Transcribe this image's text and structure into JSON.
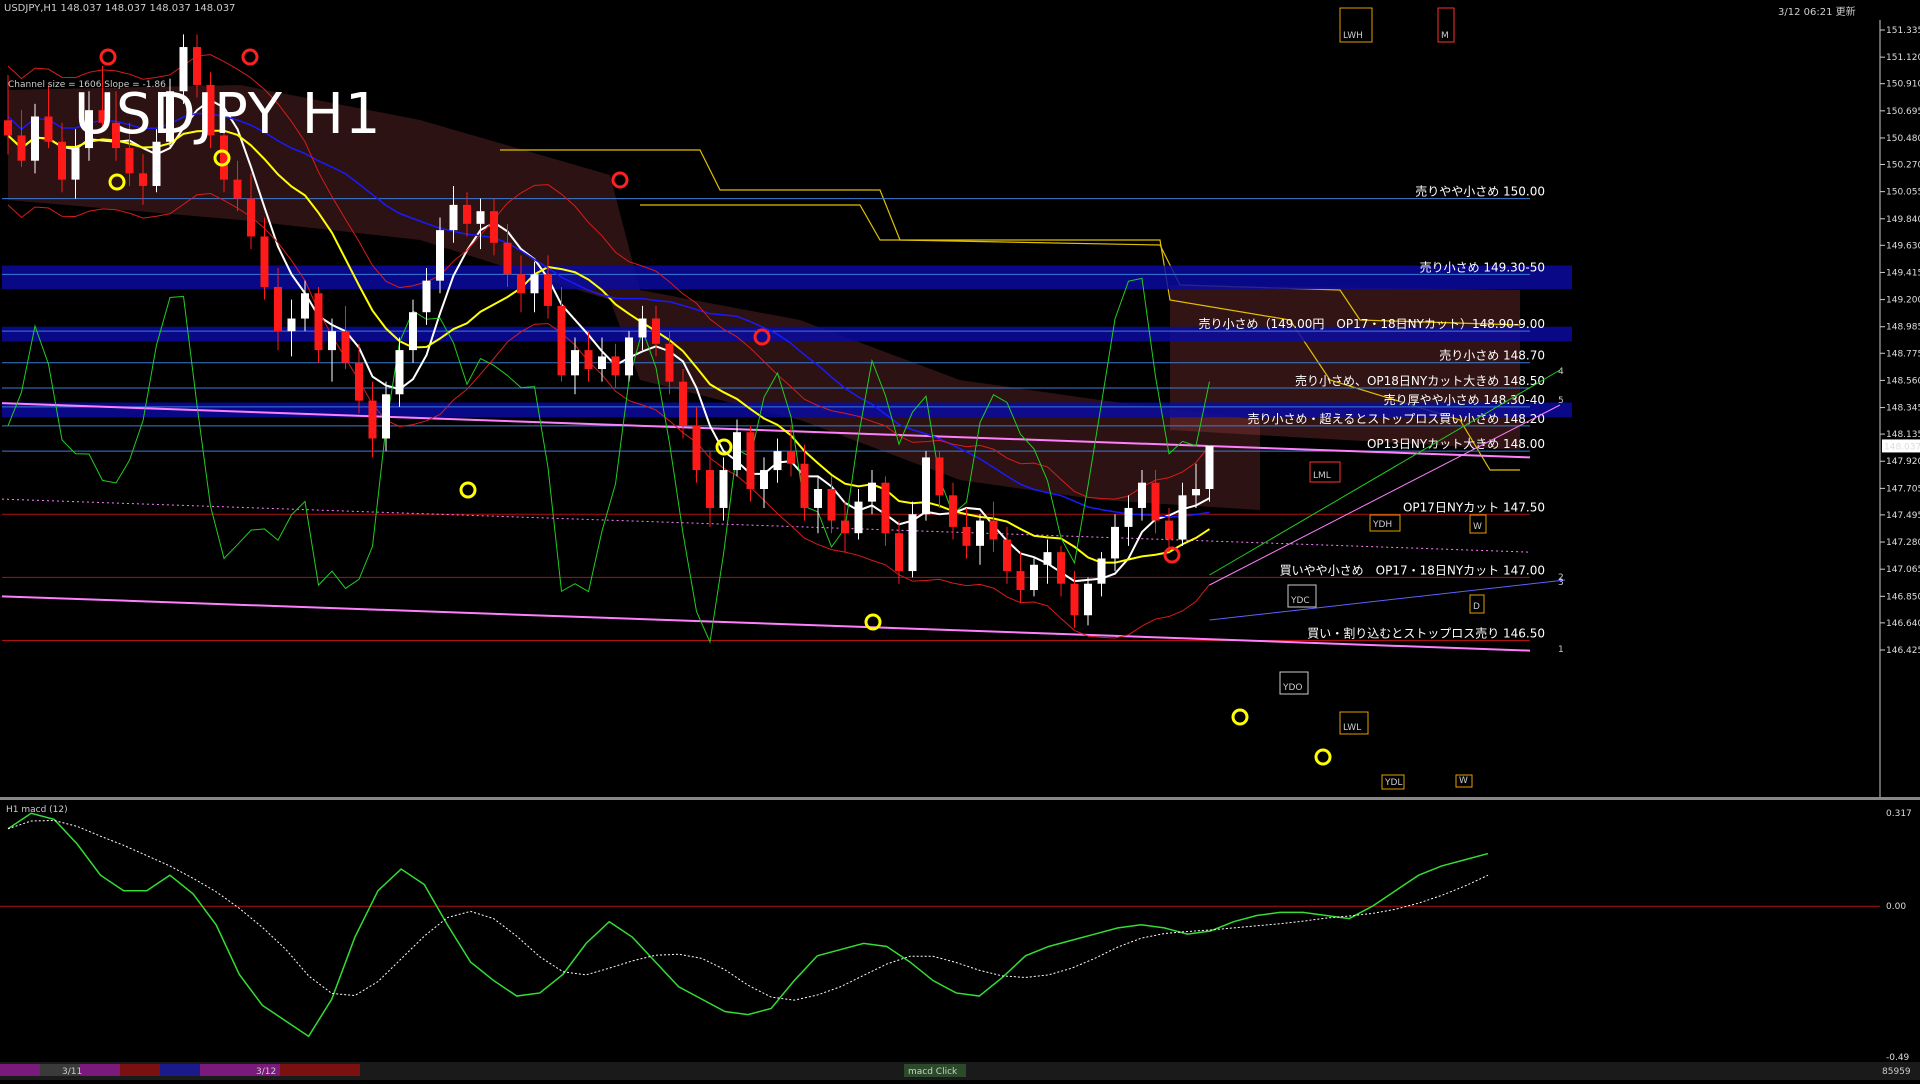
{
  "header": {
    "symbol_ohlc": "USDJPY,H1  148.037 148.037 148.037 148.037",
    "channel_info": "Channel size = 1606 Slope = -1.86",
    "update_time": "3/12 06:21 更新",
    "lwh_label": "LWH",
    "m_label": "M",
    "big_title": "USDJPY H1"
  },
  "colors": {
    "background": "#000000",
    "bull_candle": "#ffffff",
    "bear_candle": "#ff1a1a",
    "zone_fill": "#0a0aa0",
    "level_line": "#3a7bd5",
    "red_level": "#b01010",
    "macd_main": "#33dd33",
    "macd_main_neg": "#ff9aa8",
    "macd_signal": "#ffffff",
    "ichimoku_kumo": "#c85050",
    "sma_white": "#ffffff",
    "sma_yellow": "#ffff00",
    "sma_blue": "#1a1aff",
    "bollinger": "#d81c1c",
    "rsi_green": "#22cc22",
    "channel_pink": "#ff80ff",
    "cloud_edge_yellow": "#e0c000"
  },
  "price_axis": {
    "ticks": [
      "151.335",
      "151.120",
      "150.910",
      "150.695",
      "150.480",
      "150.270",
      "150.055",
      "149.840",
      "149.630",
      "149.415",
      "149.200",
      "148.985",
      "148.775",
      "148.560",
      "148.345",
      "148.135",
      "147.920",
      "147.705",
      "147.495",
      "147.280",
      "147.065",
      "146.850",
      "146.640",
      "146.425"
    ],
    "current_price": "148.037"
  },
  "levels": [
    {
      "label": "売りやや小さめ 150.00"
    },
    {
      "label": "売り小さめ 149.30-50"
    },
    {
      "label": "売り小さめ（149.00円　OP17・18日NYカット）148.90-9.00"
    },
    {
      "label": "売り小さめ 148.70"
    },
    {
      "label": "売り小さめ、OP18日NYカット大きめ 148.50"
    },
    {
      "label": "売り厚やや小さめ 148.30-40"
    },
    {
      "label": "売り小さめ・超えるとストップロス買い小さめ 148.20"
    },
    {
      "label": "OP13日NYカット大きめ 148.00"
    },
    {
      "label": "OP17日NYカット 147.50"
    },
    {
      "label": "買いやや小さめ　OP17・18日NYカット 147.00"
    },
    {
      "label": "買い・割り込むとストップロス売り 146.50"
    }
  ],
  "markers": {
    "ydh": "YDH",
    "ydc": "YDC",
    "ydo": "YDO",
    "ydl": "YDL",
    "lwl": "LWL",
    "lml": "LML",
    "w_top": "W",
    "d_mid": "D",
    "w_bot": "W",
    "n1": "1",
    "n2": "2",
    "n3": "3",
    "n4": "4",
    "n5": "5"
  },
  "macd": {
    "title": "H1  macd (12)",
    "top_value": "0.317",
    "zero_value": "0.00",
    "bottom_value": "-0.49"
  },
  "bottom_bar": {
    "date1": "3/11",
    "date2": "3/12",
    "tab": "macd Click",
    "corner": "85959"
  },
  "chart_data": {
    "type": "candlestick",
    "symbol": "USDJPY",
    "timeframe": "H1",
    "ylim": [
      146.425,
      151.335
    ],
    "candles": [
      [
        150.62,
        150.98,
        150.35,
        150.5
      ],
      [
        150.5,
        150.7,
        150.25,
        150.3
      ],
      [
        150.3,
        150.75,
        150.2,
        150.65
      ],
      [
        150.65,
        150.9,
        150.4,
        150.45
      ],
      [
        150.45,
        150.6,
        150.05,
        150.15
      ],
      [
        150.15,
        150.55,
        150.0,
        150.4
      ],
      [
        150.4,
        150.85,
        150.3,
        150.7
      ],
      [
        150.7,
        151.05,
        150.55,
        150.6
      ],
      [
        150.6,
        150.85,
        150.3,
        150.4
      ],
      [
        150.4,
        150.6,
        150.1,
        150.2
      ],
      [
        150.2,
        150.35,
        149.95,
        150.1
      ],
      [
        150.1,
        150.55,
        150.05,
        150.45
      ],
      [
        150.45,
        150.95,
        150.4,
        150.85
      ],
      [
        150.85,
        151.3,
        150.75,
        151.2
      ],
      [
        151.2,
        151.3,
        150.8,
        150.9
      ],
      [
        150.9,
        151.0,
        150.4,
        150.5
      ],
      [
        150.5,
        150.6,
        150.05,
        150.15
      ],
      [
        150.15,
        150.3,
        149.9,
        150.0
      ],
      [
        150.0,
        150.2,
        149.6,
        149.7
      ],
      [
        149.7,
        149.85,
        149.2,
        149.3
      ],
      [
        149.3,
        149.45,
        148.8,
        148.95
      ],
      [
        148.95,
        149.2,
        148.75,
        149.05
      ],
      [
        149.05,
        149.35,
        148.95,
        149.25
      ],
      [
        149.25,
        149.3,
        148.7,
        148.8
      ],
      [
        148.8,
        149.05,
        148.55,
        148.95
      ],
      [
        148.95,
        149.15,
        148.65,
        148.7
      ],
      [
        148.7,
        148.85,
        148.3,
        148.4
      ],
      [
        148.4,
        148.55,
        147.95,
        148.1
      ],
      [
        148.1,
        148.55,
        148.0,
        148.45
      ],
      [
        148.45,
        148.9,
        148.35,
        148.8
      ],
      [
        148.8,
        149.2,
        148.7,
        149.1
      ],
      [
        149.1,
        149.45,
        149.0,
        149.35
      ],
      [
        149.35,
        149.85,
        149.25,
        149.75
      ],
      [
        149.75,
        150.1,
        149.65,
        149.95
      ],
      [
        149.95,
        150.05,
        149.7,
        149.8
      ],
      [
        149.8,
        150.0,
        149.6,
        149.9
      ],
      [
        149.9,
        150.0,
        149.55,
        149.65
      ],
      [
        149.65,
        149.8,
        149.3,
        149.4
      ],
      [
        149.4,
        149.55,
        149.1,
        149.25
      ],
      [
        149.25,
        149.5,
        149.1,
        149.4
      ],
      [
        149.4,
        149.55,
        149.05,
        149.15
      ],
      [
        149.15,
        149.3,
        148.55,
        148.6
      ],
      [
        148.6,
        148.9,
        148.45,
        148.8
      ],
      [
        148.8,
        148.95,
        148.55,
        148.65
      ],
      [
        148.65,
        148.9,
        148.55,
        148.75
      ],
      [
        148.75,
        148.85,
        148.5,
        148.6
      ],
      [
        148.6,
        148.95,
        148.55,
        148.9
      ],
      [
        148.9,
        149.15,
        148.8,
        149.05
      ],
      [
        149.05,
        149.15,
        148.75,
        148.85
      ],
      [
        148.85,
        148.95,
        148.45,
        148.55
      ],
      [
        148.55,
        148.65,
        148.1,
        148.2
      ],
      [
        148.2,
        148.35,
        147.75,
        147.85
      ],
      [
        147.85,
        148.0,
        147.4,
        147.55
      ],
      [
        147.55,
        147.95,
        147.45,
        147.85
      ],
      [
        147.85,
        148.25,
        147.8,
        148.15
      ],
      [
        148.15,
        148.2,
        147.6,
        147.7
      ],
      [
        147.7,
        147.95,
        147.55,
        147.85
      ],
      [
        147.85,
        148.1,
        147.75,
        148.0
      ],
      [
        148.0,
        148.2,
        147.8,
        147.9
      ],
      [
        147.9,
        148.05,
        147.45,
        147.55
      ],
      [
        147.55,
        147.8,
        147.35,
        147.7
      ],
      [
        147.7,
        147.8,
        147.35,
        147.45
      ],
      [
        147.45,
        147.6,
        147.2,
        147.35
      ],
      [
        147.35,
        147.7,
        147.3,
        147.6
      ],
      [
        147.6,
        147.85,
        147.5,
        147.75
      ],
      [
        147.75,
        147.8,
        147.25,
        147.35
      ],
      [
        147.35,
        147.45,
        146.95,
        147.05
      ],
      [
        147.05,
        147.6,
        147.0,
        147.5
      ],
      [
        147.5,
        148.0,
        147.45,
        147.95
      ],
      [
        147.95,
        148.0,
        147.55,
        147.65
      ],
      [
        147.65,
        147.75,
        147.3,
        147.4
      ],
      [
        147.4,
        147.55,
        147.15,
        147.25
      ],
      [
        147.25,
        147.5,
        147.1,
        147.45
      ],
      [
        147.45,
        147.6,
        147.2,
        147.3
      ],
      [
        147.3,
        147.4,
        146.95,
        147.05
      ],
      [
        147.05,
        147.2,
        146.8,
        146.9
      ],
      [
        146.9,
        147.15,
        146.85,
        147.1
      ],
      [
        147.1,
        147.3,
        146.95,
        147.2
      ],
      [
        147.2,
        147.25,
        146.85,
        146.95
      ],
      [
        146.95,
        147.05,
        146.6,
        146.7
      ],
      [
        146.7,
        147.0,
        146.62,
        146.95
      ],
      [
        146.95,
        147.2,
        146.85,
        147.15
      ],
      [
        147.15,
        147.5,
        147.05,
        147.4
      ],
      [
        147.4,
        147.65,
        147.25,
        147.55
      ],
      [
        147.55,
        147.85,
        147.45,
        147.75
      ],
      [
        147.75,
        147.85,
        147.35,
        147.45
      ],
      [
        147.45,
        147.55,
        147.2,
        147.3
      ],
      [
        147.3,
        147.75,
        147.25,
        147.65
      ],
      [
        147.65,
        147.9,
        147.55,
        147.7
      ],
      [
        147.7,
        148.04,
        147.6,
        148.04
      ]
    ],
    "indicators": [
      "SMA (white)",
      "SMA (yellow)",
      "SMA (blue)",
      "Bollinger Bands (red)",
      "Ichimoku Kumo",
      "RSI (green)",
      "Channel (pink)"
    ],
    "macd_ylim": [
      -0.49,
      0.317
    ]
  }
}
